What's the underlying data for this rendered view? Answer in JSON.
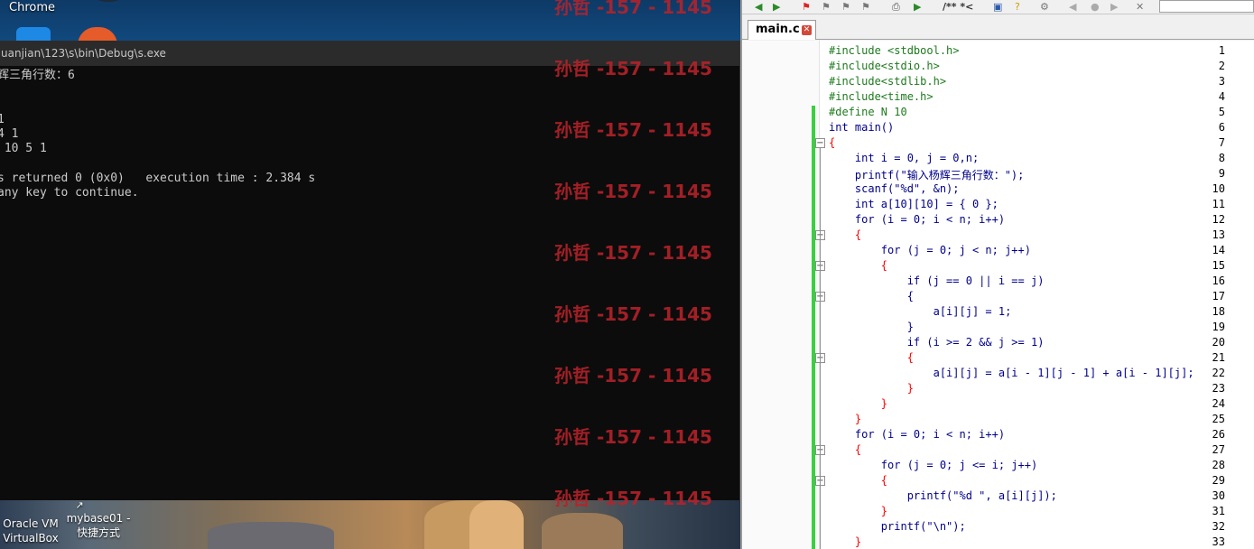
{
  "desktop": {
    "chrome_label": "Chrome",
    "icons": [
      {
        "label_line1": "Oracle VM",
        "label_line2": "VirtualBox"
      },
      {
        "label_line1": "mybase01 -",
        "label_line2": "快捷方式"
      }
    ]
  },
  "console": {
    "title": "uanjian\\123\\s\\bin\\Debug\\s.exe",
    "lines": [
      "辉三角行数：6",
      "",
      "",
      "1",
      "4 1",
      " 10 5 1",
      "",
      "s returned 0 (0x0)   execution time : 2.384 s",
      "any key to continue."
    ]
  },
  "watermark": {
    "text": "孙哲 -157 - 1145",
    "color": "#b8222a"
  },
  "editor": {
    "tab_label": "main.c",
    "toolbar_comment": "/** *<",
    "lines": [
      {
        "n": "1",
        "code": "#include <stdbool.h>"
      },
      {
        "n": "2",
        "code": "#include<stdio.h>"
      },
      {
        "n": "3",
        "code": "#include<stdlib.h>"
      },
      {
        "n": "4",
        "code": "#include<time.h>"
      },
      {
        "n": "5",
        "code": "#define N 10"
      },
      {
        "n": "6",
        "code": "int main()"
      },
      {
        "n": "7",
        "code": "{"
      },
      {
        "n": "8",
        "code": "    int i = 0, j = 0,n;"
      },
      {
        "n": "9",
        "code": "    printf(\"输入杨辉三角行数：\");"
      },
      {
        "n": "10",
        "code": "    scanf(\"%d\", &n);"
      },
      {
        "n": "11",
        "code": "    int a[10][10] = { 0 };"
      },
      {
        "n": "12",
        "code": "    for (i = 0; i < n; i++)"
      },
      {
        "n": "13",
        "code": "    {"
      },
      {
        "n": "14",
        "code": "        for (j = 0; j < n; j++)"
      },
      {
        "n": "15",
        "code": "        {"
      },
      {
        "n": "16",
        "code": "            if (j == 0 || i == j)"
      },
      {
        "n": "17",
        "code": "            {"
      },
      {
        "n": "18",
        "code": "                a[i][j] = 1;"
      },
      {
        "n": "19",
        "code": "            }"
      },
      {
        "n": "20",
        "code": "            if (i >= 2 && j >= 1)"
      },
      {
        "n": "21",
        "code": "            {"
      },
      {
        "n": "22",
        "code": "                a[i][j] = a[i - 1][j - 1] + a[i - 1][j];"
      },
      {
        "n": "23",
        "code": "            }"
      },
      {
        "n": "24",
        "code": "        }"
      },
      {
        "n": "25",
        "code": "    }"
      },
      {
        "n": "26",
        "code": "    for (i = 0; i < n; i++)"
      },
      {
        "n": "27",
        "code": "    {"
      },
      {
        "n": "28",
        "code": "        for (j = 0; j <= i; j++)"
      },
      {
        "n": "29",
        "code": "        {"
      },
      {
        "n": "30",
        "code": "            printf(\"%d \", a[i][j]);"
      },
      {
        "n": "31",
        "code": "        }"
      },
      {
        "n": "32",
        "code": "        printf(\"\\n\");"
      },
      {
        "n": "33",
        "code": "    }"
      }
    ]
  }
}
